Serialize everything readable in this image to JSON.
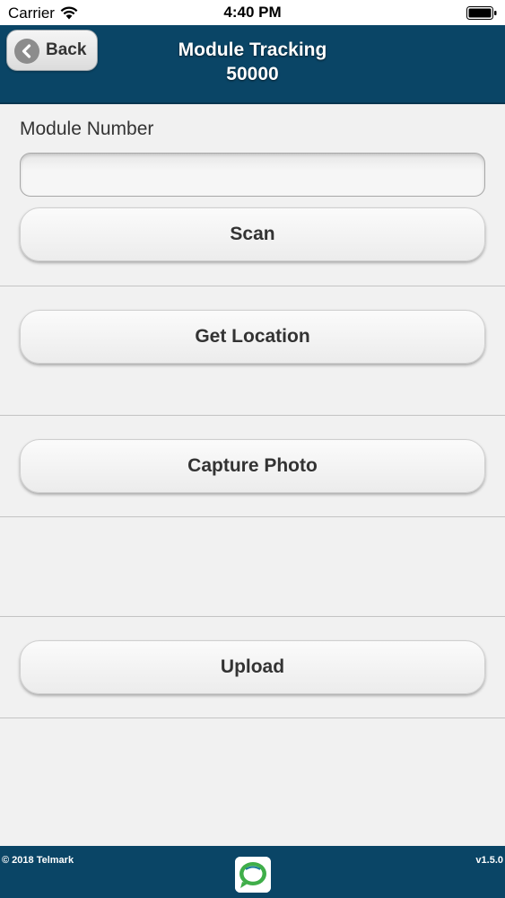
{
  "status_bar": {
    "carrier": "Carrier",
    "time": "4:40 PM"
  },
  "header": {
    "back_label": "Back",
    "title_line1": "Module Tracking",
    "title_line2": "50000"
  },
  "form": {
    "module_number_label": "Module Number",
    "module_number_value": "",
    "scan_label": "Scan",
    "get_location_label": "Get Location",
    "capture_photo_label": "Capture Photo",
    "upload_label": "Upload"
  },
  "footer": {
    "copyright": "© 2018 Telmark",
    "version": "v1.5.0"
  },
  "colors": {
    "header_bg": "#0a4566",
    "page_bg": "#f1f1f1",
    "logo_green": "#3fae49"
  },
  "icons": {
    "wifi": "wifi-icon",
    "battery": "battery-icon",
    "back": "chevron-left-icon",
    "logo": "telmark-logo-icon"
  }
}
